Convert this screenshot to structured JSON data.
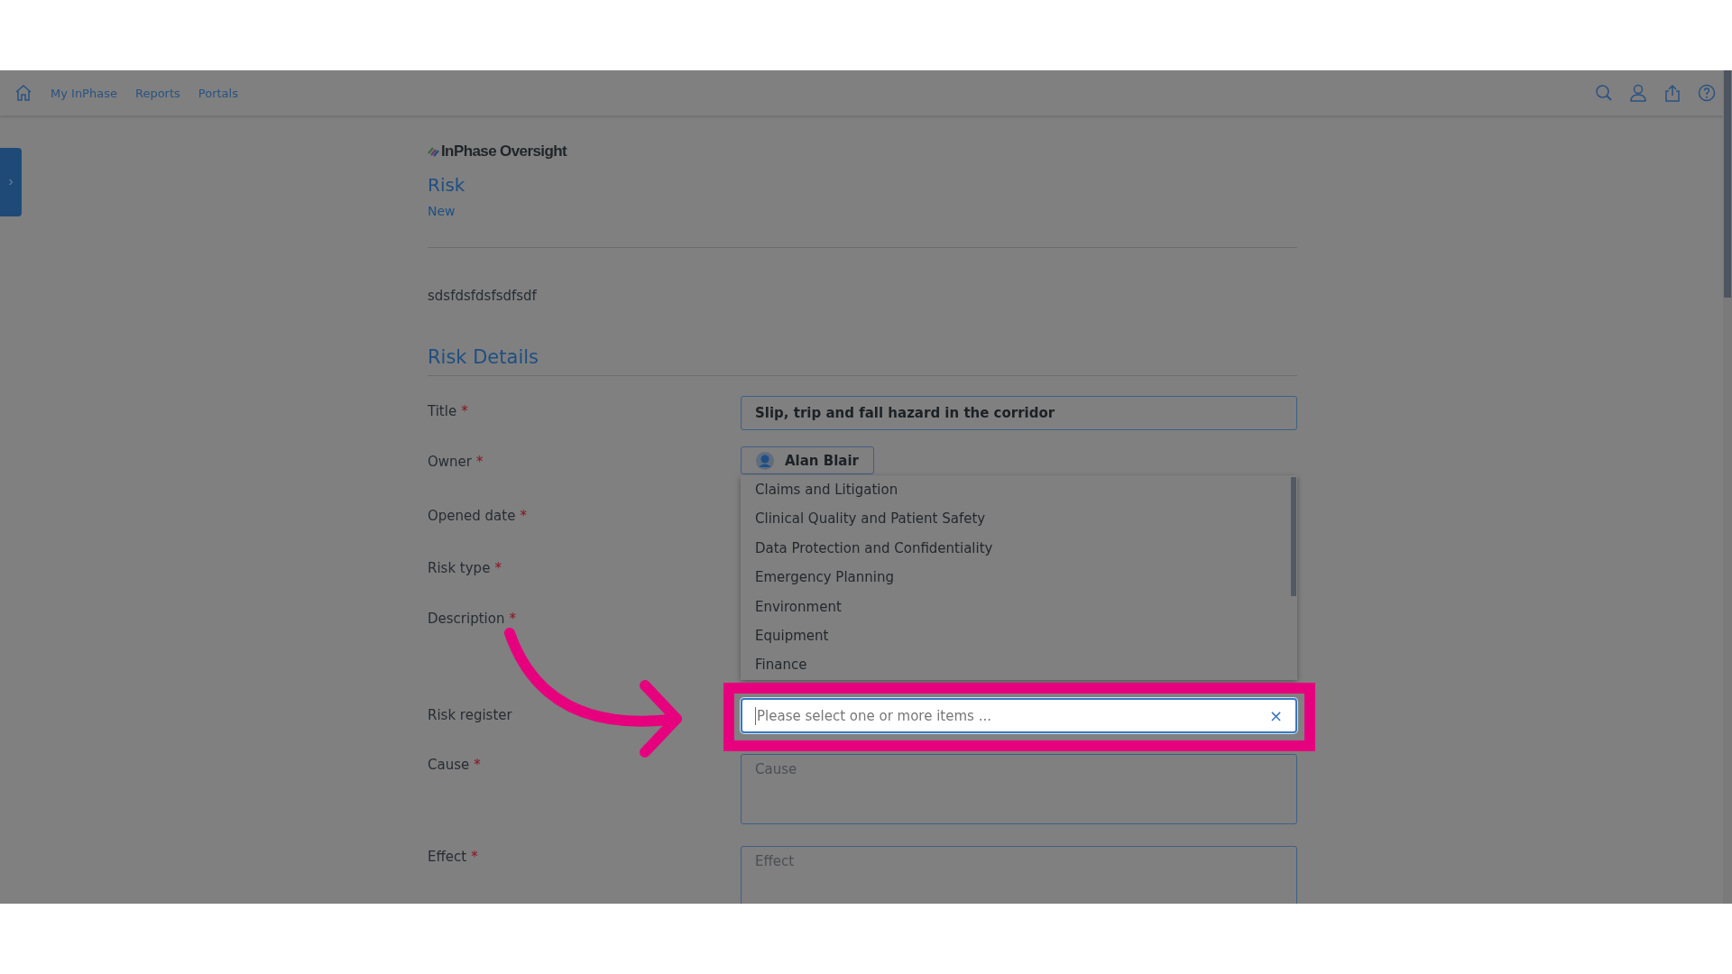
{
  "nav": {
    "items": [
      "My InPhase",
      "Reports",
      "Portals"
    ]
  },
  "header": {
    "logo": "InPhase Oversight",
    "title": "Risk",
    "subtitle": "New",
    "reference": "sdsfdsfdsfsdfsdf"
  },
  "section": {
    "title": "Risk Details"
  },
  "fields": [
    {
      "kind": "text",
      "label": "Title",
      "required_mark": "*",
      "value": "Slip, trip and fall hazard in the corridor"
    },
    {
      "kind": "person",
      "label": "Owner",
      "required_mark": "*",
      "value": "Alan Blair"
    },
    {
      "kind": "hidden",
      "label": "Opened date",
      "required_mark": "*"
    },
    {
      "kind": "hidden",
      "label": "Risk type",
      "required_mark": "*"
    },
    {
      "kind": "hidden",
      "label": "Description",
      "required_mark": "*"
    },
    {
      "kind": "multiselect",
      "label": "Risk register",
      "placeholder": "Please select one or more items ...",
      "clear": "×",
      "highlighted": true
    },
    {
      "kind": "textarea",
      "label": "Cause",
      "required_mark": "*",
      "placeholder": "Cause"
    },
    {
      "kind": "textarea",
      "label": "Effect",
      "required_mark": "*",
      "placeholder": "Effect"
    }
  ],
  "dropdown": {
    "options": [
      "Claims and Litigation",
      "Clinical Quality and Patient Safety",
      "Data Protection and Confidentiality",
      "Emergency Planning",
      "Environment",
      "Equipment",
      "Finance"
    ]
  }
}
